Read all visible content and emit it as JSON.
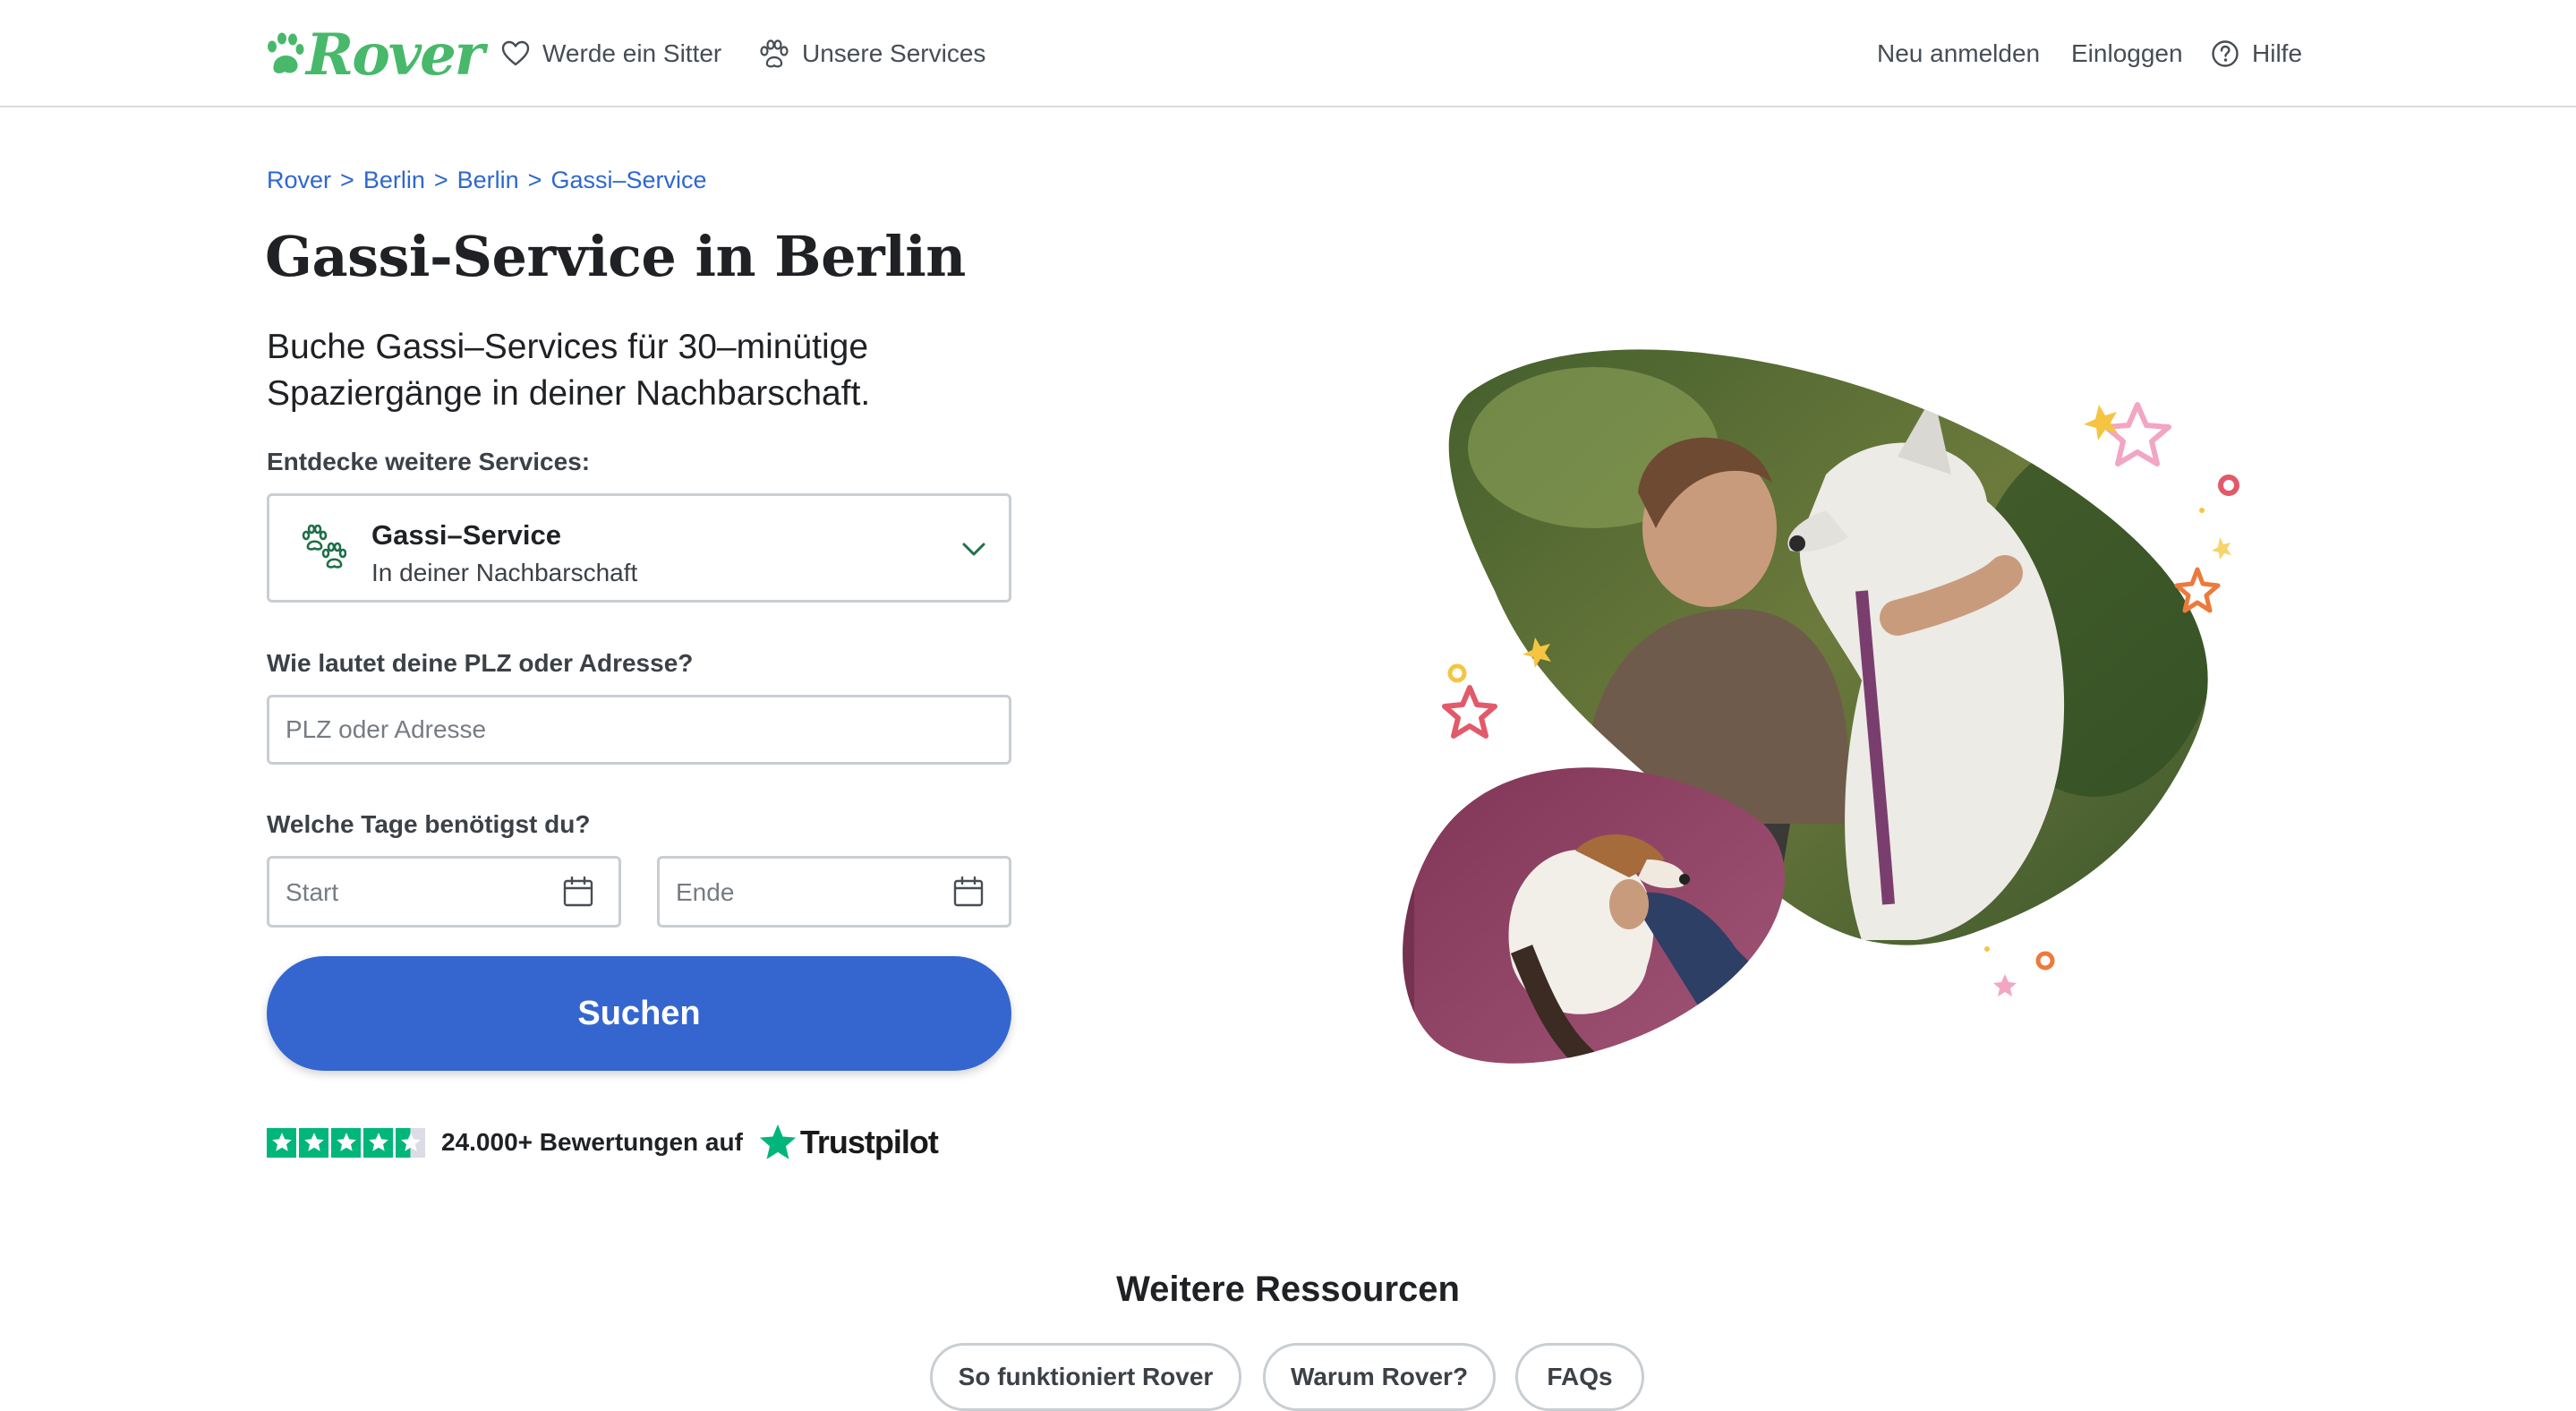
{
  "header": {
    "logo_text": "Rover",
    "nav": {
      "become_sitter": "Werde ein Sitter",
      "our_services": "Unsere Services",
      "sign_up": "Neu anmelden",
      "login": "Einloggen",
      "help": "Hilfe"
    }
  },
  "breadcrumb": [
    "Rover",
    ">",
    "Berlin",
    ">",
    "Berlin",
    ">",
    "Gassi–Service"
  ],
  "page_title": "Gassi-Service in Berlin",
  "subtitle": "Buche Gassi–Services für 30–minütige Spaziergänge in deiner Nachbarschaft.",
  "form": {
    "services_label": "Entdecke weitere Services:",
    "service": {
      "name": "Gassi–Service",
      "sub": "In deiner Nachbarschaft"
    },
    "address_label": "Wie lautet deine PLZ oder Adresse?",
    "address_placeholder": "PLZ oder Adresse",
    "address_value": "",
    "dates_label": "Welche Tage benötigst du?",
    "start_placeholder": "Start",
    "end_placeholder": "Ende",
    "search_label": "Suchen"
  },
  "trust": {
    "text": "24.000+ Bewertungen auf",
    "brand": "Trustpilot",
    "rating_stars": 4.5
  },
  "resources": {
    "title": "Weitere Ressourcen",
    "links": [
      "So funktioniert Rover",
      "Warum Rover?",
      "FAQs"
    ]
  },
  "colors": {
    "brand_green": "#48b86b",
    "primary_blue": "#3566cf",
    "link_blue": "#2e67d1",
    "trustpilot_green": "#00b67a"
  },
  "icons": {
    "logo": "paw-logo-icon",
    "become_sitter": "heart-icon",
    "our_services": "paw-icon",
    "help": "help-circle-icon",
    "service": "dog-walking-paws-icon",
    "dropdown": "chevron-down-icon",
    "date": "calendar-icon"
  }
}
